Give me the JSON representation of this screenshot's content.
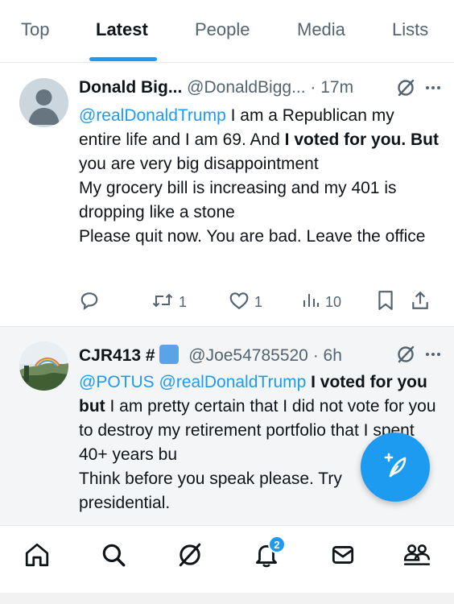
{
  "tabs": [
    {
      "label": "Top"
    },
    {
      "label": "Latest"
    },
    {
      "label": "People"
    },
    {
      "label": "Media"
    },
    {
      "label": "Lists"
    }
  ],
  "active_tab": "Latest",
  "posts": [
    {
      "name": "Donald Big...",
      "handle": "@DonaldBigg...",
      "time": "· 17m",
      "avatar_icon": "default-avatar-icon",
      "text": {
        "mention": "@realDonaldTrump",
        "t1": " I am a Republican my entire life and I am 69. And ",
        "b1": "I voted for you. But",
        "t2": " you are very big disappointment",
        "line2": "My grocery bill is increasing and my 401 is dropping like a stone",
        "line3": "Please quit now. You are bad. Leave the office"
      },
      "actions": {
        "replies": "",
        "reposts": "1",
        "likes": "1",
        "views": "10"
      }
    },
    {
      "name": "CJR413 #",
      "handle": "@Joe54785520",
      "time": "· 6h",
      "avatar_icon": "landscape-avatar-icon",
      "text": {
        "mention1": "@POTUS",
        "mention2": "@realDonaldTrump",
        "b1": " I voted for you but",
        "t1": " I am pretty certain that I did not vote for you to destroy my retirement portfolio that I spent 40+ years bu",
        "line2": "Think before you speak please. Try",
        "line3": "presidential."
      }
    }
  ],
  "notifications_badge": "2",
  "colors": {
    "accent": "#1d9bf0",
    "text": "#0f1419",
    "secondary": "#536471"
  }
}
